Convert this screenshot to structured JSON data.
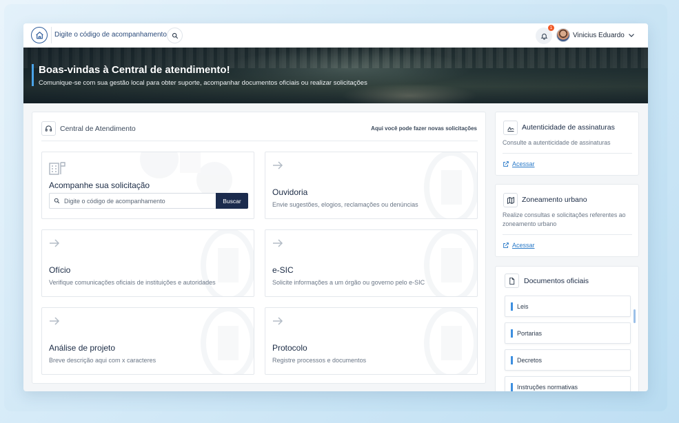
{
  "topbar": {
    "search_placeholder": "Digite o código de acompanhamento",
    "notification_count": "1",
    "user_name": "Vinicius Eduardo"
  },
  "hero": {
    "title": "Boas-vindas à Central de atendimento!",
    "subtitle": "Comunique-se com sua gestão local para obter suporte, acompanhar documentos oficiais ou realizar solicitações"
  },
  "main": {
    "title": "Central de Atendimento",
    "hint": "Aqui você pode fazer novas solicitações",
    "track": {
      "title": "Acompanhe sua solicitação",
      "placeholder": "Digite o código de acompanhamento",
      "button": "Buscar"
    },
    "cards": [
      {
        "title": "Ouvidoria",
        "desc": "Envie sugestões, elogios, reclamações ou denúncias"
      },
      {
        "title": "Ofício",
        "desc": "Verifique comunicações oficiais de instituições e autoridades"
      },
      {
        "title": "e-SIC",
        "desc": "Solicite informações a um órgão ou governo pelo e-SIC"
      },
      {
        "title": "Análise de projeto",
        "desc": "Breve descrição aqui com x caracteres"
      },
      {
        "title": "Protocolo",
        "desc": "Registre processos e documentos"
      }
    ]
  },
  "side": {
    "signatures": {
      "title": "Autenticidade de assinaturas",
      "desc": "Consulte a autenticidade de assinaturas",
      "link": "Acessar"
    },
    "zoning": {
      "title": "Zoneamento urbano",
      "desc": "Realize consultas e solicitações referentes ao zoneamento urbano",
      "link": "Acessar"
    },
    "documents": {
      "title": "Documentos oficiais",
      "items": [
        "Leis",
        "Portarias",
        "Decretos",
        "Instruções normativas"
      ]
    }
  },
  "colors": {
    "accent": "#3d8fe0",
    "primary_dark": "#1b2b4d",
    "notification": "#f05a28",
    "link": "#2a7ac8"
  }
}
